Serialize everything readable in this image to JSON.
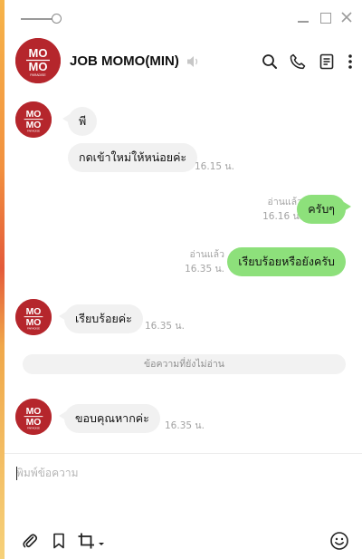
{
  "window": {
    "controls": [
      "minimize-icon",
      "maximize-icon",
      "close-icon"
    ]
  },
  "header": {
    "title": "JOB MOMO(MIN)",
    "avatar_text": [
      "MO",
      "MO",
      "PARADISE"
    ],
    "icons": [
      "search-icon",
      "phone-icon",
      "notes-icon",
      "more-icon"
    ]
  },
  "messages": [
    {
      "side": "in",
      "text": "พี",
      "time": ""
    },
    {
      "side": "in",
      "text": "กดเข้าใหม่ให้หน่อยค่ะ",
      "time": "16.15 น."
    },
    {
      "side": "out",
      "text": "ครับๆ",
      "read": "อ่านแล้ว",
      "time": "16.16 น."
    },
    {
      "side": "out",
      "text": "เรียบร้อยหรือยังครับ",
      "read": "อ่านแล้ว",
      "time": "16.35 น."
    },
    {
      "side": "in",
      "text": "เรียบร้อยค่ะ",
      "time": "16.35 น."
    },
    {
      "side": "in",
      "text": "ขอบคุณหากค่ะ",
      "time": "16.35 น."
    }
  ],
  "unread_divider": "ข้อความที่ยังไม่อ่าน",
  "input": {
    "placeholder": "พิมพ์ข้อความ",
    "value": ""
  },
  "toolbar": {
    "icons": [
      "paperclip-icon",
      "bookmark-icon",
      "crop-icon",
      "emoji-icon"
    ]
  },
  "colors": {
    "brand_red": "#b5262c",
    "outgoing_bubble": "#8de07b",
    "incoming_bubble": "#f1f1f1"
  }
}
